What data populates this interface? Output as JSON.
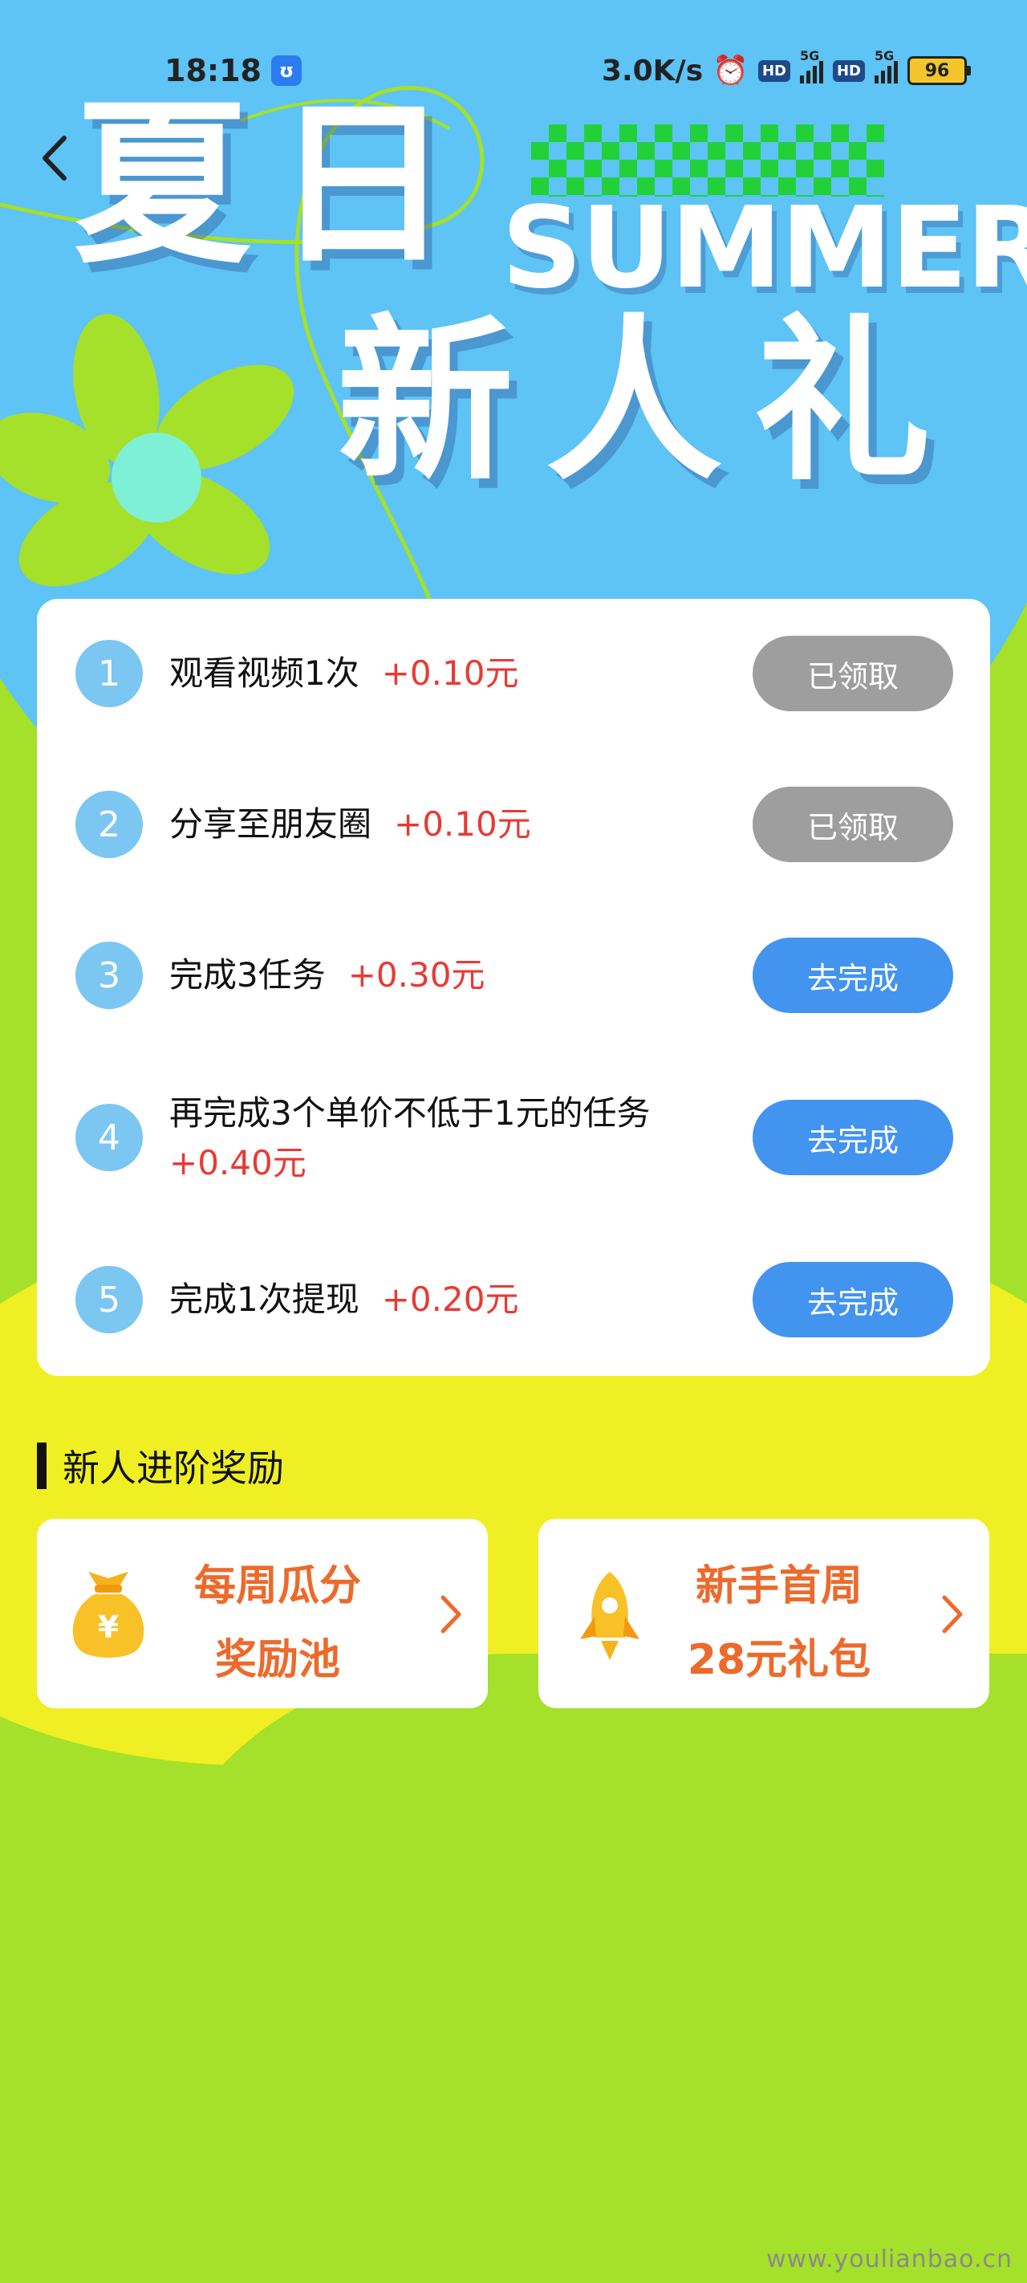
{
  "status_bar": {
    "time": "18:18",
    "net_speed": "3.0K/s",
    "sim1_label": "HD",
    "sim1_net": "5G",
    "sim2_label": "HD",
    "sim2_net": "5G",
    "battery": "96"
  },
  "hero": {
    "title_line1": "夏日",
    "title_en": "SUMMER",
    "title_line2": "新人礼"
  },
  "tasks": [
    {
      "num": "1",
      "text": "观看视频1次",
      "reward": "+0.10元",
      "button": "已领取",
      "state": "done"
    },
    {
      "num": "2",
      "text": "分享至朋友圈",
      "reward": "+0.10元",
      "button": "已领取",
      "state": "done"
    },
    {
      "num": "3",
      "text": "完成3任务",
      "reward": "+0.30元",
      "button": "去完成",
      "state": "todo"
    },
    {
      "num": "4",
      "text": "再完成3个单价不低于1元的任务",
      "reward": "+0.40元",
      "button": "去完成",
      "state": "todo"
    },
    {
      "num": "5",
      "text": "完成1次提现",
      "reward": "+0.20元",
      "button": "去完成",
      "state": "todo"
    }
  ],
  "advanced": {
    "title": "新人进阶奖励",
    "cards": [
      {
        "line1": "每周瓜分",
        "line2": "奖励池",
        "icon": "money-bag-icon"
      },
      {
        "line1": "新手首周",
        "line2": "28元礼包",
        "icon": "rocket-icon"
      }
    ]
  },
  "watermark": "www.youlianbao.cn",
  "colors": {
    "sky_blue": "#5ec3f5",
    "lime": "#a5e02a",
    "yellow": "#efef24",
    "reward_red": "#e83a35",
    "button_blue": "#4294ef",
    "button_gray": "#9e9e9e",
    "card_orange": "#ec6a2b"
  }
}
